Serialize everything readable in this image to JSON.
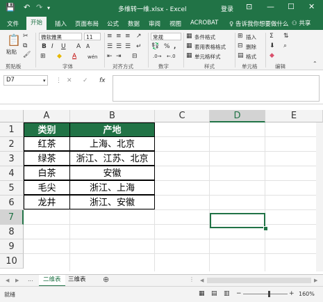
{
  "window": {
    "title": "多维转一维.xlsx  -  Excel",
    "login": "登录",
    "controls": [
      "⊡",
      "—",
      "☐",
      "✕"
    ]
  },
  "qat": {
    "save": "💾",
    "undo": "↶",
    "redo": "↷",
    "customize": "▾"
  },
  "ribbon_tabs": [
    "文件",
    "开始",
    "插入",
    "页面布局",
    "公式",
    "数据",
    "审阅",
    "视图",
    "ACROBAT"
  ],
  "active_tab": "开始",
  "tell_me": "告诉我你想要做什么",
  "share": "共享",
  "ribbon": {
    "clipboard": {
      "paste": "粘贴",
      "label": "剪贴板"
    },
    "font": {
      "name": "微软雅黑",
      "size": "11",
      "bold": "B",
      "italic": "I",
      "underline": "U",
      "grow": "A",
      "shrink": "A",
      "font_color": "A",
      "wen": "wén",
      "label": "字体"
    },
    "alignment": {
      "label": "对齐方式"
    },
    "number": {
      "format": "常规",
      "percent": "%",
      "comma": ",",
      "label": "数字"
    },
    "styles": {
      "conditional": "条件格式",
      "table": "套用表格格式",
      "cell": "单元格样式",
      "label": "样式"
    },
    "cells": {
      "insert": "插入",
      "delete": "删除",
      "format": "格式",
      "label": "单元格"
    },
    "editing": {
      "sum": "Σ",
      "label": "编辑"
    }
  },
  "formula_bar": {
    "name_box": "D7",
    "cancel": "✕",
    "enter": "✓",
    "fx": "fx",
    "value": ""
  },
  "columns": [
    "A",
    "B",
    "C",
    "D",
    "E"
  ],
  "selected_column": "D",
  "rows": [
    "1",
    "2",
    "3",
    "4",
    "5",
    "6",
    "7",
    "8",
    "9",
    "10"
  ],
  "selected_row": "7",
  "table": {
    "header": [
      "类别",
      "产地"
    ],
    "body": [
      [
        "红茶",
        "上海、北京"
      ],
      [
        "绿茶",
        "浙江、江苏、北京"
      ],
      [
        "白茶",
        "安徽"
      ],
      [
        "毛尖",
        "浙江、上海"
      ],
      [
        "龙井",
        "浙江、安徽"
      ]
    ]
  },
  "sheet_tabs": [
    "二维表",
    "三维表"
  ],
  "active_sheet": "二维表",
  "sheet_nav": {
    "ellipsis": "...",
    "add": "⊕"
  },
  "status": {
    "text": "就绪",
    "zoom": "160%",
    "minus": "−",
    "plus": "+"
  },
  "accent_color": "#217346"
}
